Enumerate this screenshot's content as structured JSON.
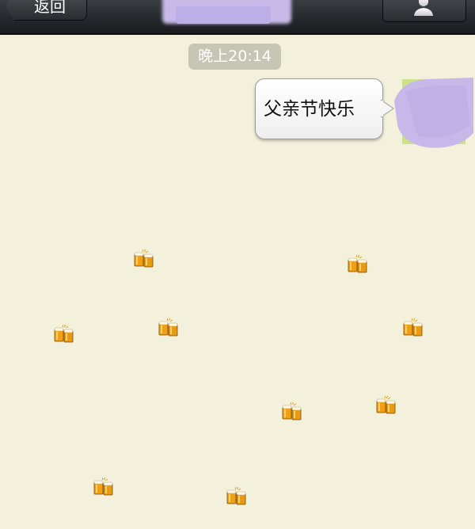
{
  "navbar": {
    "back_label": "返回"
  },
  "chat": {
    "timestamp": "晚上20:14",
    "message": "父亲节快乐"
  },
  "effects": {
    "emoji": "beer-mugs"
  },
  "colors": {
    "background": "#f3f0dc",
    "navbar": "#25282c",
    "timestamp_bg": "#c7c6b4",
    "bubble": "#ffffff",
    "redaction": "#c7b9e8",
    "beer": "#f2a012"
  }
}
